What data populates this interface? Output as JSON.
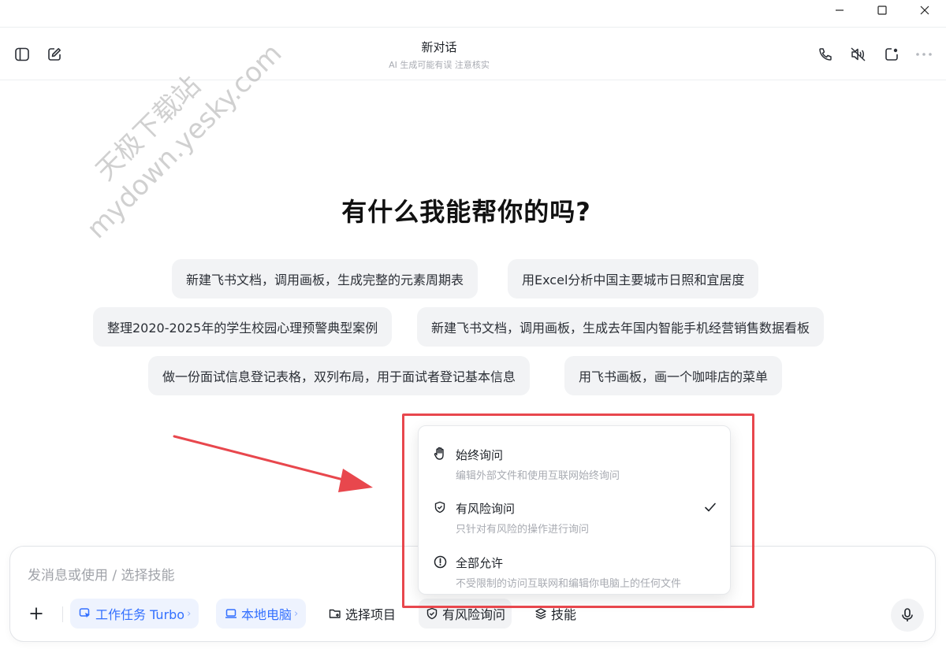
{
  "header": {
    "title": "新对话",
    "subtitle": "AI 生成可能有误 注意核实"
  },
  "main": {
    "heading": "有什么我能帮你的吗?",
    "suggestions": [
      "新建飞书文档，调用画板，生成完整的元素周期表",
      "用Excel分析中国主要城市日照和宜居度",
      "整理2020-2025年的学生校园心理预警典型案例",
      "新建飞书文档，调用画板，生成去年国内智能手机经营销售数据看板",
      "做一份面试信息登记表格，双列布局，用于面试者登记基本信息",
      "用飞书画板，画一个咖啡店的菜单"
    ]
  },
  "watermark": {
    "line1": "天极下载站",
    "line2": "mydown.yesky.com"
  },
  "permission_menu": {
    "items": [
      {
        "title": "始终询问",
        "desc": "编辑外部文件和使用互联网始终询问",
        "icon": "hand-icon",
        "selected": false
      },
      {
        "title": "有风险询问",
        "desc": "只针对有风险的操作进行询问",
        "icon": "shield-check-icon",
        "selected": true
      },
      {
        "title": "全部允许",
        "desc": "不受限制的访问互联网和编辑你电脑上的任何文件",
        "icon": "alert-circle-icon",
        "selected": false
      }
    ]
  },
  "composer": {
    "placeholder": "发消息或使用 / 选择技能",
    "task_mode": "工作任务 Turbo",
    "local_computer": "本地电脑",
    "select_project": "选择项目",
    "permission": "有风险询问",
    "skills": "技能"
  },
  "colors": {
    "accent": "#3370ff",
    "highlight_red": "#e8474d",
    "chip_bg": "#f2f3f5"
  }
}
